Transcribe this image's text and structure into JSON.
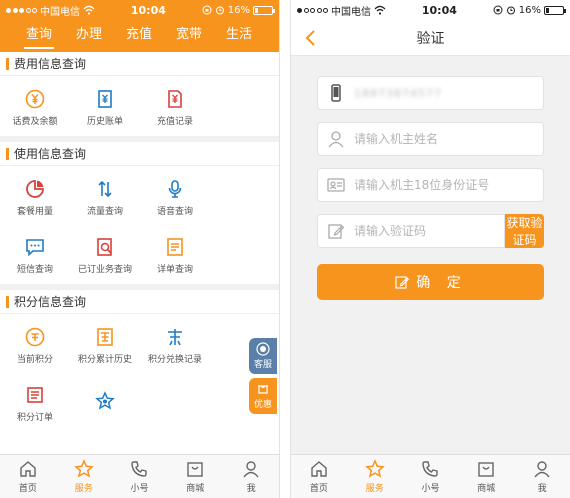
{
  "status_left": {
    "carrier": "中国电信",
    "time": "10:04",
    "battery": "16%"
  },
  "status_right": {
    "carrier": "中国电信",
    "time": "10:04",
    "battery": "16%"
  },
  "battery_level": 0.16,
  "accent_color": "#f7941d",
  "tabs": [
    "查询",
    "办理",
    "充值",
    "宽带",
    "生活"
  ],
  "sections": {
    "fee": {
      "title": "费用信息查询",
      "items": [
        {
          "label": "话费及余额",
          "icon": "yuan-coin-icon"
        },
        {
          "label": "历史账单",
          "icon": "bill-icon"
        },
        {
          "label": "充值记录",
          "icon": "recharge-record-icon"
        }
      ]
    },
    "usage": {
      "title": "使用信息查询",
      "items": [
        {
          "label": "套餐用量",
          "icon": "pie-chart-icon"
        },
        {
          "label": "流量查询",
          "icon": "data-arrows-icon"
        },
        {
          "label": "语音查询",
          "icon": "microphone-icon"
        },
        {
          "label": "短信查询",
          "icon": "message-icon"
        },
        {
          "label": "已订业务查询",
          "icon": "subscribed-service-icon"
        },
        {
          "label": "详单查询",
          "icon": "detail-list-icon"
        }
      ]
    },
    "points": {
      "title": "积分信息查询",
      "items": [
        {
          "label": "当前积分",
          "icon": "points-coin-icon"
        },
        {
          "label": "积分累计历史",
          "icon": "points-history-icon"
        },
        {
          "label": "积分兑换记录",
          "icon": "points-exchange-icon"
        },
        {
          "label": "积分订单",
          "icon": "points-order-icon"
        },
        {
          "label": "",
          "icon": "star-badge-icon"
        }
      ]
    }
  },
  "floating": {
    "kefu": "客服",
    "youhui": "优惠"
  },
  "bottom_nav": [
    {
      "label": "首页",
      "icon": "home-icon"
    },
    {
      "label": "服务",
      "icon": "star-icon"
    },
    {
      "label": "小号",
      "icon": "phone-icon"
    },
    {
      "label": "商城",
      "icon": "mall-icon"
    },
    {
      "label": "我",
      "icon": "user-icon"
    }
  ],
  "verify": {
    "title": "验证",
    "phone_value": "18973874577",
    "name_placeholder": "请输入机主姓名",
    "id_placeholder": "请输入机主18位身份证号",
    "code_placeholder": "请输入验证码",
    "code_button": "获取验证码",
    "confirm_label": "确 定"
  }
}
